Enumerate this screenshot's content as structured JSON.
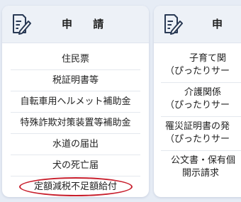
{
  "left_card": {
    "title": "申 請",
    "icon": "document-pen-icon",
    "items": [
      "住民票",
      "税証明書等",
      "自転車用ヘルメット補助金",
      "特殊詐欺対策装置等補助金",
      "水道の届出",
      "犬の死亡届",
      "定額減税不足額給付"
    ]
  },
  "right_card": {
    "title": "申 請",
    "icon": "document-pen-icon",
    "items": [
      {
        "line1": "子育て関",
        "line2": "（ぴったりサー"
      },
      {
        "line1": "介護関係",
        "line2": "（ぴったりサー"
      },
      {
        "line1": "罹災証明書の発",
        "line2": "（ぴったりサー"
      },
      {
        "line1": "公文書・保有個",
        "line2": "開示請求"
      }
    ]
  },
  "colors": {
    "background": "#e6ecf5",
    "card": "#ffffff",
    "header": "#edf1f7",
    "highlight_ellipse": "#c81e2c"
  }
}
